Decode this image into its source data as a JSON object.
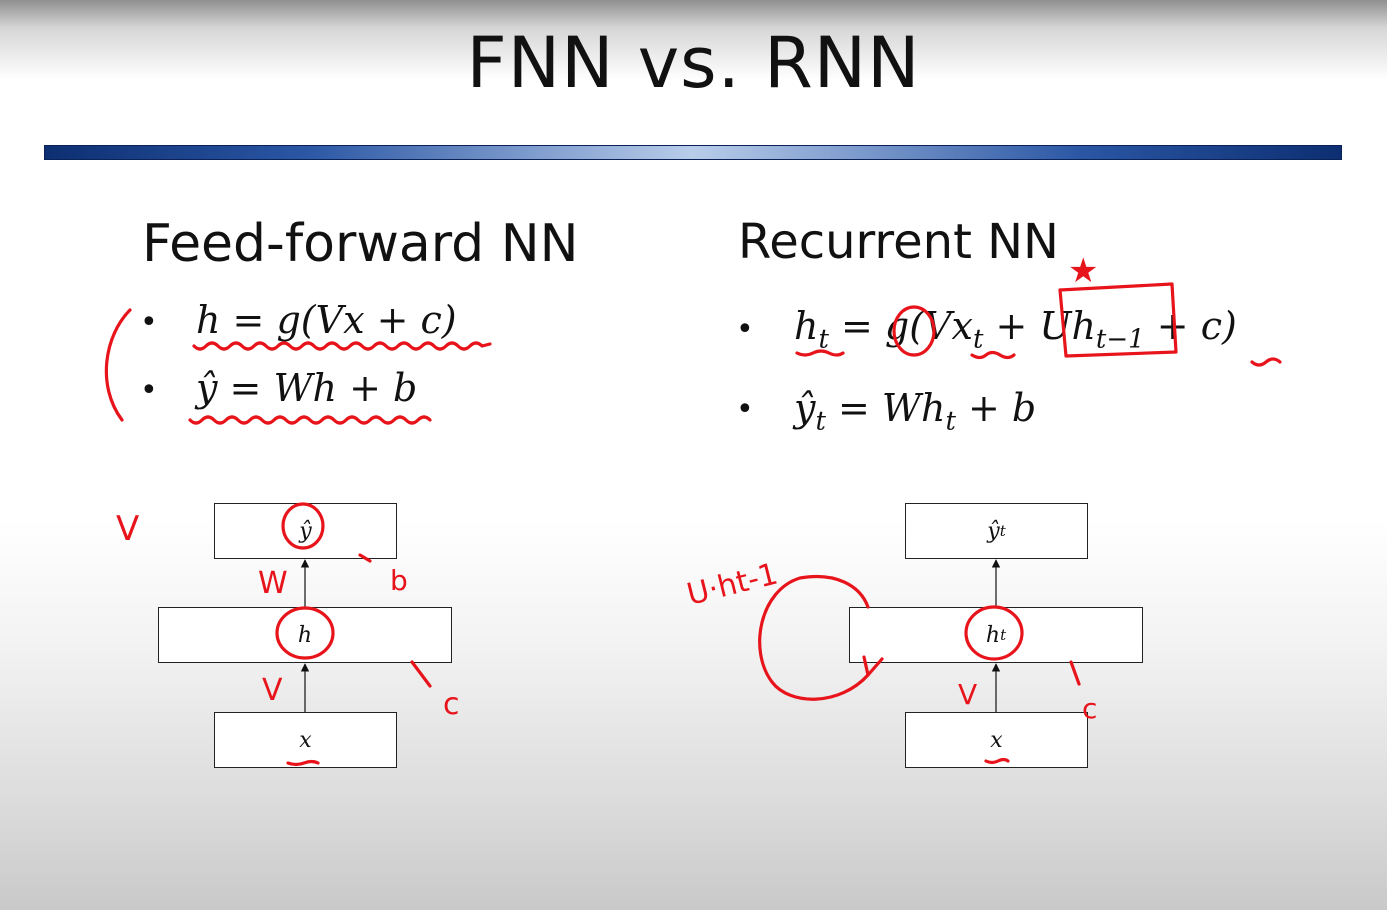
{
  "slide": {
    "title": "FNN vs. RNN"
  },
  "feedforward": {
    "heading": "Feed-forward NN",
    "bullet_symbol": "•",
    "eq1": "h = g(Vx + c)",
    "eq2": "ŷ = Wh + b",
    "diagram": {
      "output": "ŷ",
      "hidden": "h",
      "input": "x"
    }
  },
  "recurrent": {
    "heading": "Recurrent NN",
    "bullet_symbol": "•",
    "eq1": {
      "h": "h",
      "h_sub": "t",
      "middle": " = g(Vx",
      "x_sub": "t",
      "plus": " + Uh",
      "uh_sub": "t−1",
      "tail": " + c)"
    },
    "eq2": {
      "y": "ŷ",
      "y_sub": "t",
      "middle": " = Wh",
      "h_sub": "t",
      "tail": " + b"
    },
    "diagram": {
      "output": "ŷ",
      "output_sub": "t",
      "hidden": "h",
      "hidden_sub": "t",
      "input": "x"
    }
  },
  "annotations": {
    "color": "#e8141b",
    "left_v": "V",
    "left_w": "W",
    "left_b": "b",
    "left_v2": "V",
    "left_c": "c",
    "right_uht": "U·ht-1",
    "right_v": "V",
    "right_c": "c",
    "star": "★"
  }
}
